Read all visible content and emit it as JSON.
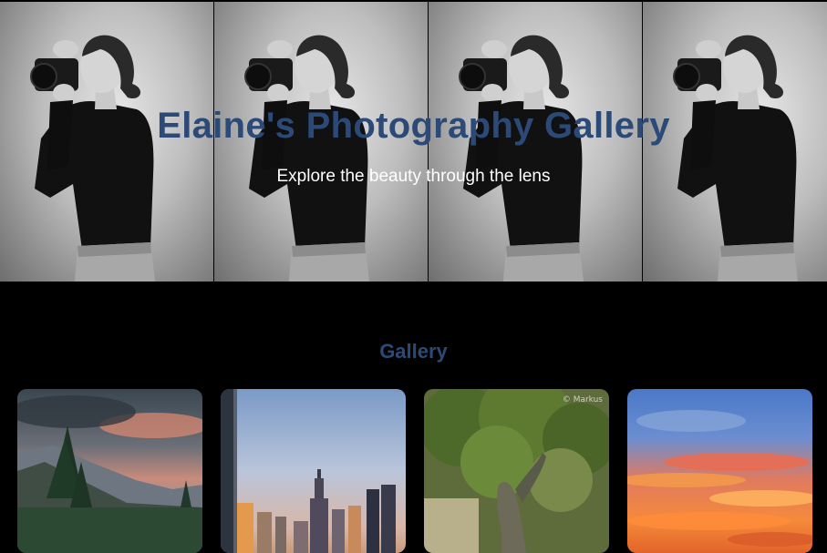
{
  "hero": {
    "title": "Elaine's Photography Gallery",
    "subtitle": "Explore the beauty through the lens",
    "photo_alt": "Photographer holding camera"
  },
  "gallery": {
    "title": "Gallery",
    "items": [
      {
        "name": "mountain-forest-sunset-photo"
      },
      {
        "name": "city-skyline-photo"
      },
      {
        "name": "old-tree-photo"
      },
      {
        "name": "fiery-sunset-sky-photo"
      }
    ]
  },
  "colors": {
    "accent": "#2c4a78",
    "background": "#000000",
    "subtitle": "#ffffff"
  }
}
